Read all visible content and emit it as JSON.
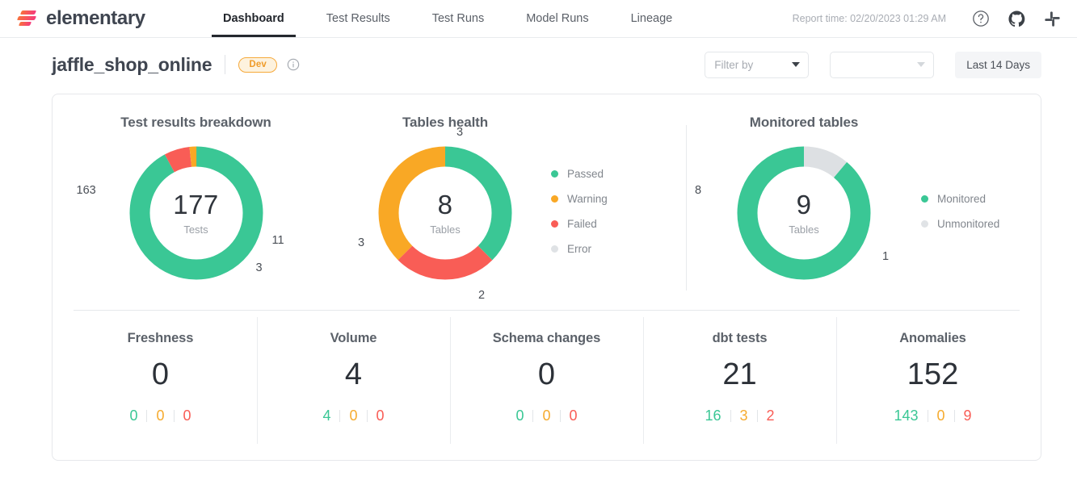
{
  "colors": {
    "passed": "#3ac795",
    "warning": "#f9a825",
    "failed": "#f95d56",
    "error": "#dcdfe2",
    "unmonitored": "#dbdfe2"
  },
  "nav": {
    "brand": "elementary",
    "logo_icon": "elementary-logo",
    "tabs": [
      {
        "label": "Dashboard",
        "active": true
      },
      {
        "label": "Test Results",
        "active": false
      },
      {
        "label": "Test Runs",
        "active": false
      },
      {
        "label": "Model Runs",
        "active": false
      },
      {
        "label": "Lineage",
        "active": false
      }
    ],
    "report_time": "Report time: 02/20/2023 01:29 AM",
    "icons": {
      "help": "help-circle-icon",
      "github": "github-icon",
      "slack": "slack-icon"
    }
  },
  "header": {
    "project": "jaffle_shop_online",
    "env_badge": "Dev",
    "info_icon": "info-circle-icon",
    "filter_placeholder": "Filter by",
    "secondary_placeholder": "",
    "date_range": "Last 14 Days"
  },
  "legend": {
    "items": [
      {
        "label": "Passed",
        "color": "#3ac795"
      },
      {
        "label": "Warning",
        "color": "#f9a825"
      },
      {
        "label": "Failed",
        "color": "#f95d56"
      },
      {
        "label": "Error",
        "color": "#dfe2e5"
      }
    ]
  },
  "monitored_legend": {
    "items": [
      {
        "label": "Monitored",
        "color": "#3ac795"
      },
      {
        "label": "Unmonitored",
        "color": "#e0e3e6"
      }
    ]
  },
  "chart_data": [
    {
      "type": "pie",
      "title": "Test results breakdown",
      "center_value": "177",
      "center_label": "Tests",
      "categories": [
        "Passed",
        "Failed",
        "Warning"
      ],
      "values": [
        163,
        11,
        3
      ],
      "colors": [
        "#3ac795",
        "#f95d56",
        "#f9a825"
      ],
      "labels": [
        "163",
        "11",
        "3"
      ],
      "legend": "shared-right"
    },
    {
      "type": "pie",
      "title": "Tables health",
      "center_value": "8",
      "center_label": "Tables",
      "categories": [
        "Passed",
        "Failed",
        "Warning"
      ],
      "values": [
        3,
        2,
        3
      ],
      "colors": [
        "#3ac795",
        "#f95d56",
        "#f9a825"
      ],
      "labels": [
        "3",
        "2",
        "3"
      ],
      "legend": "shared-right"
    },
    {
      "type": "pie",
      "title": "Monitored tables",
      "center_value": "9",
      "center_label": "Tables",
      "categories": [
        "Monitored",
        "Unmonitored"
      ],
      "values": [
        8,
        1
      ],
      "colors": [
        "#3ac795",
        "#dde0e3"
      ],
      "labels": [
        "8",
        "1"
      ],
      "legend": "right"
    }
  ],
  "stats": [
    {
      "title": "Freshness",
      "total": "0",
      "passed": "0",
      "warning": "0",
      "failed": "0"
    },
    {
      "title": "Volume",
      "total": "4",
      "passed": "4",
      "warning": "0",
      "failed": "0"
    },
    {
      "title": "Schema changes",
      "total": "0",
      "passed": "0",
      "warning": "0",
      "failed": "0"
    },
    {
      "title": "dbt tests",
      "total": "21",
      "passed": "16",
      "warning": "3",
      "failed": "2"
    },
    {
      "title": "Anomalies",
      "total": "152",
      "passed": "143",
      "warning": "0",
      "failed": "9"
    }
  ]
}
